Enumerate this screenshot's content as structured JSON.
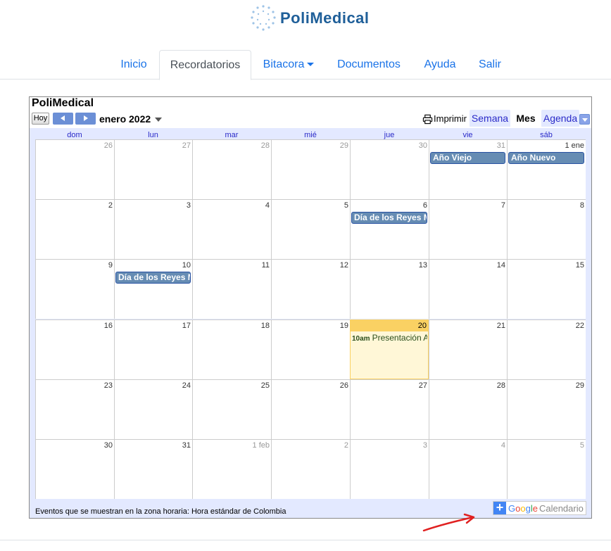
{
  "brand": {
    "name": "PoliMedical",
    "color": "#1f5f99"
  },
  "nav": {
    "items": [
      {
        "label": "Inicio"
      },
      {
        "label": "Recordatorios",
        "active": true
      },
      {
        "label": "Bitacora",
        "dropdown": true
      },
      {
        "label": "Documentos"
      },
      {
        "label": "Ayuda"
      },
      {
        "label": "Salir"
      }
    ]
  },
  "calendar": {
    "title": "PoliMedical",
    "today_button": "Hoy",
    "month_label": "enero 2022",
    "print_label": "Imprimir",
    "views": [
      "Semana",
      "Mes",
      "Agenda"
    ],
    "selected_view": "Mes",
    "weekdays": [
      "dom",
      "lun",
      "mar",
      "mié",
      "jue",
      "vie",
      "sáb"
    ],
    "weeks": [
      [
        "26",
        "27",
        "28",
        "29",
        "30",
        "31",
        "1 ene"
      ],
      [
        "2",
        "3",
        "4",
        "5",
        "6",
        "7",
        "8"
      ],
      [
        "9",
        "10",
        "11",
        "12",
        "13",
        "14",
        "15"
      ],
      [
        "16",
        "17",
        "18",
        "19",
        "20",
        "21",
        "22"
      ],
      [
        "23",
        "24",
        "25",
        "26",
        "27",
        "28",
        "29"
      ],
      [
        "30",
        "31",
        "1 feb",
        "2",
        "3",
        "4",
        "5"
      ]
    ],
    "events": [
      {
        "label": "Año Viejo",
        "week": 0,
        "day": 5
      },
      {
        "label": "Año Nuevo",
        "week": 0,
        "day": 6
      },
      {
        "label": "Día de los Reyes Magos",
        "week": 1,
        "day": 4
      },
      {
        "label": "Día de los Reyes Magos",
        "week": 2,
        "day": 1
      }
    ],
    "timed_event": {
      "time": "10am",
      "label": "Presentación A",
      "week": 3,
      "day": 4
    },
    "today": "20",
    "timezone_text": "Eventos que se muestran en la zona horaria: Hora estándar de Colombia",
    "google_button": {
      "plus": "+",
      "g": "G",
      "o1": "o",
      "o2": "o",
      "g2": "g",
      "l": "l",
      "e": "e",
      "calendario": "Calendario"
    },
    "accent_color": "#668cb3",
    "today_color": "#fad163"
  },
  "annotation": {
    "arrow_color": "#e02020"
  }
}
